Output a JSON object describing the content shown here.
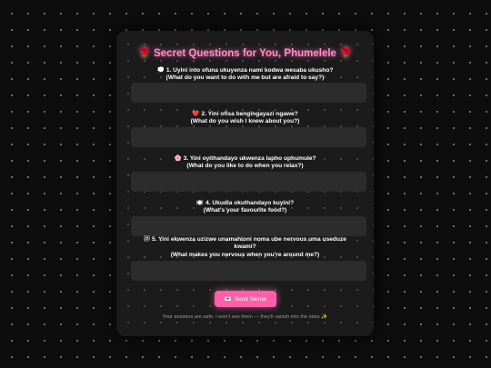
{
  "title": "🌹 Secret Questions for You, Phumelele 🌹",
  "questions": [
    {
      "emoji": "💭",
      "line1": "1. Uyini into ofuna ukuyenza nami kodwa wesaba ukusho?",
      "line2": "(What do you want to do with me but are afraid to say?)",
      "value": "",
      "placeholder": ""
    },
    {
      "emoji": "❤️",
      "line1": "2. Yini ofisa bengingayazi ngawe?",
      "line2": "(What do you wish I knew about you?)",
      "value": "",
      "placeholder": ""
    },
    {
      "emoji": "🌸",
      "line1": "3. Yini oyithandayo ukwenza lapho uphumule?",
      "line2": "(What do you like to do when you relax?)",
      "value": "",
      "placeholder": ""
    },
    {
      "emoji": "🍽️",
      "line1": "4. Ukudla okuthandayo kuyini?",
      "line2": "(What's your favourite food?)",
      "value": "",
      "placeholder": ""
    },
    {
      "emoji": "😻",
      "line1": "5. Yini ekwenza uzizwe unamahloni noma ube nervous uma useduze",
      "line1b": "kwami?",
      "line2": "(What makes you nervous when you're around me?)",
      "value": "",
      "placeholder": ""
    }
  ],
  "send_button": {
    "icon": "💌",
    "label": "Send Secret"
  },
  "footer": "Your answers are safe. I won't see them — they'll vanish into the stars ✨"
}
